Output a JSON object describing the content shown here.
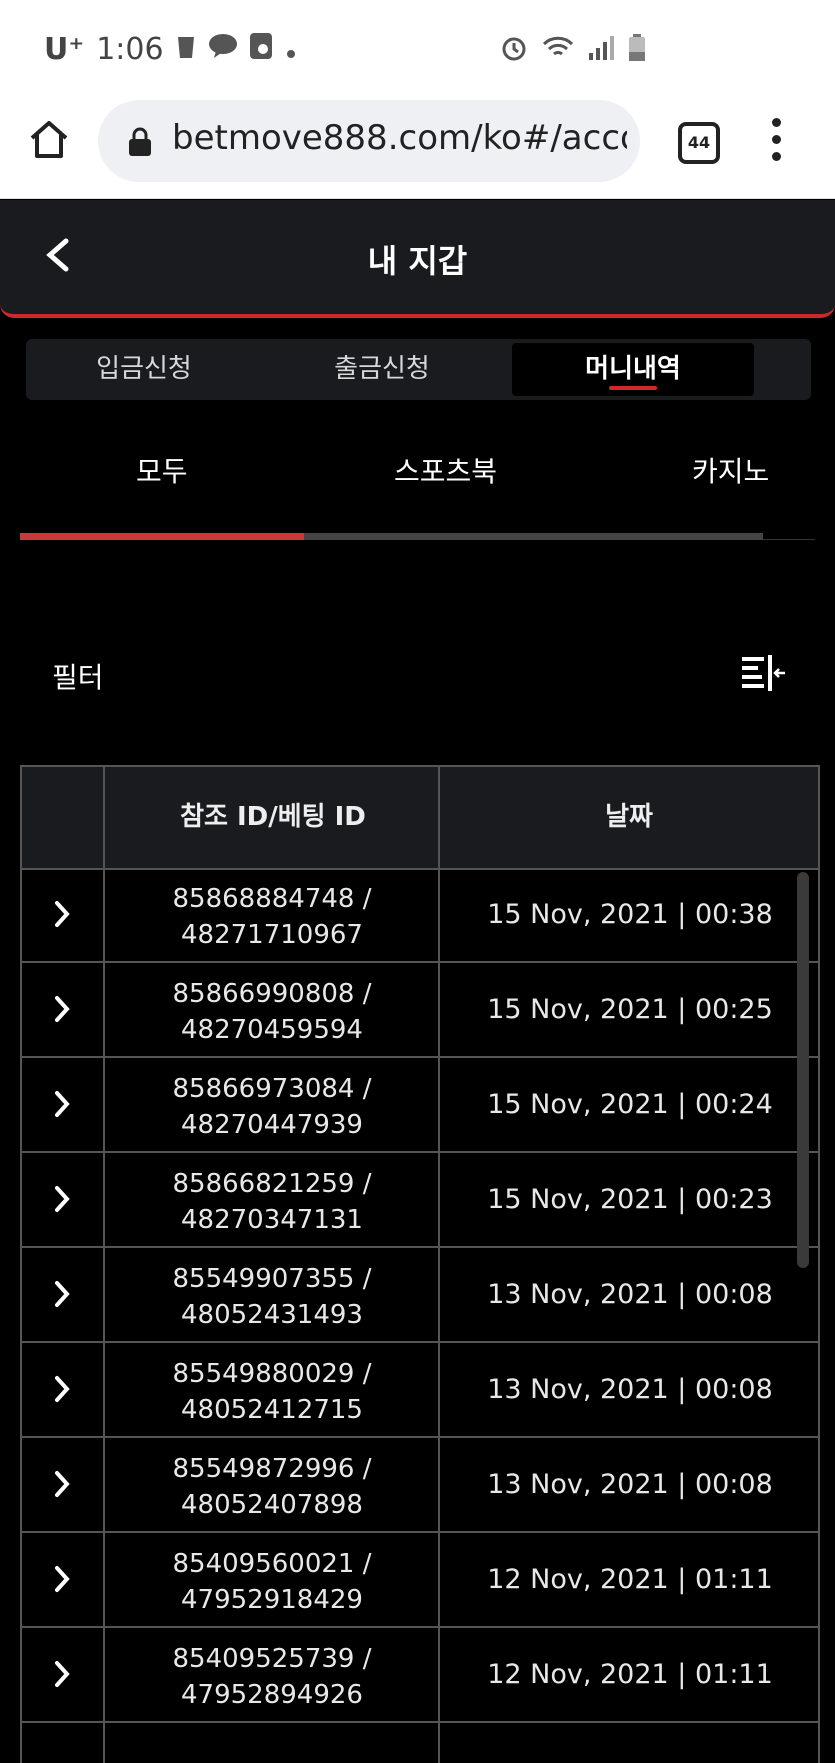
{
  "status_bar": {
    "carrier": "U⁺",
    "time": "1:06"
  },
  "browser": {
    "url": "betmove888.com/ko#/accour",
    "tab_count": "44"
  },
  "header": {
    "title": "내 지갑"
  },
  "segments": [
    {
      "label": "입금신청",
      "active": false
    },
    {
      "label": "출금신청",
      "active": false
    },
    {
      "label": "머니내역",
      "active": true
    }
  ],
  "categories": [
    {
      "label": "모두",
      "active": true
    },
    {
      "label": "스포츠북",
      "active": false
    },
    {
      "label": "카지노",
      "active": false
    }
  ],
  "filter": {
    "label": "필터"
  },
  "table": {
    "headers": [
      "참조 ID/베팅 ID",
      "날짜"
    ],
    "rows": [
      {
        "ref_id": "85868884748 /",
        "bet_id": "48271710967",
        "date": "15 Nov, 2021 | 00:38"
      },
      {
        "ref_id": "85866990808 /",
        "bet_id": "48270459594",
        "date": "15 Nov, 2021 | 00:25"
      },
      {
        "ref_id": "85866973084 /",
        "bet_id": "48270447939",
        "date": "15 Nov, 2021 | 00:24"
      },
      {
        "ref_id": "85866821259 /",
        "bet_id": "48270347131",
        "date": "15 Nov, 2021 | 00:23"
      },
      {
        "ref_id": "85549907355 /",
        "bet_id": "48052431493",
        "date": "13 Nov, 2021 | 00:08"
      },
      {
        "ref_id": "85549880029 /",
        "bet_id": "48052412715",
        "date": "13 Nov, 2021 | 00:08"
      },
      {
        "ref_id": "85549872996 /",
        "bet_id": "48052407898",
        "date": "13 Nov, 2021 | 00:08"
      },
      {
        "ref_id": "85409560021 /",
        "bet_id": "47952918429",
        "date": "12 Nov, 2021 | 01:11"
      },
      {
        "ref_id": "85409525739 /",
        "bet_id": "47952894926",
        "date": "12 Nov, 2021 | 01:11"
      }
    ]
  },
  "colors": {
    "accent": "#d0282a",
    "header_bg": "#1a1b1f",
    "background": "#000000"
  }
}
